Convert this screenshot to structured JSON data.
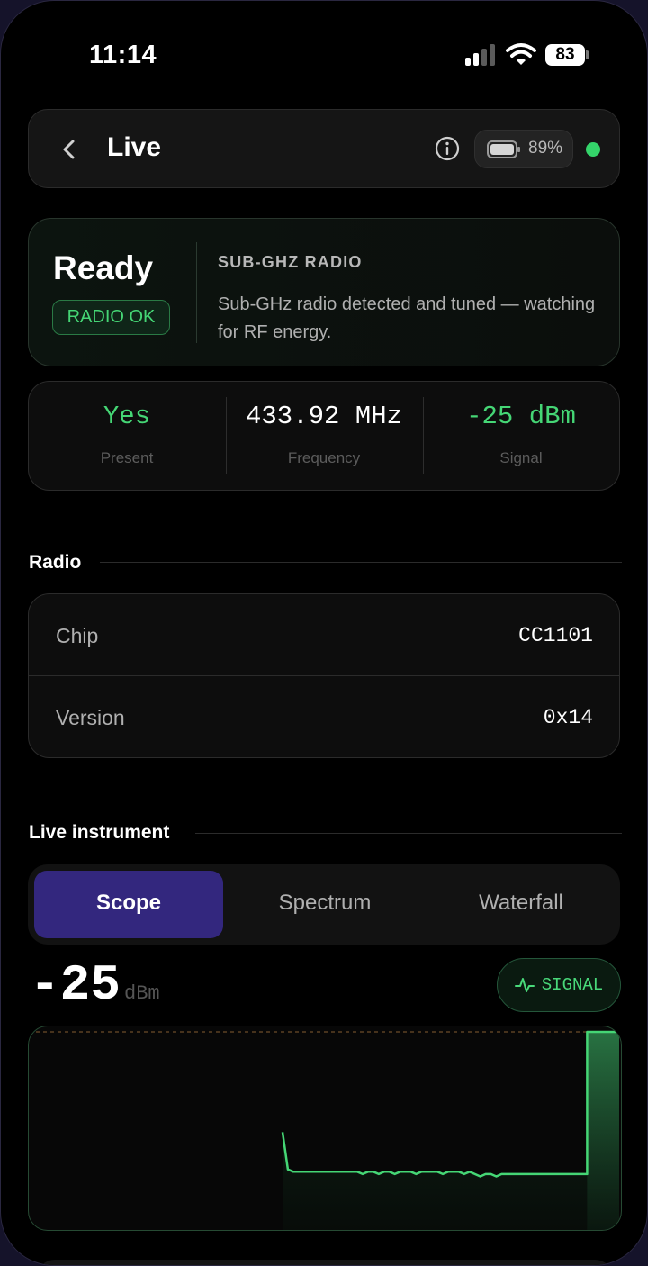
{
  "status_bar": {
    "time": "11:14",
    "battery": "83"
  },
  "header": {
    "title": "Live",
    "battery_percent": "89%",
    "connection_color": "#34d46a"
  },
  "status_card": {
    "state": "Ready",
    "badge": "RADIO OK",
    "module": "SUB-GHZ RADIO",
    "description": "Sub-GHz radio detected and tuned — watching for RF energy."
  },
  "metrics": [
    {
      "value": "Yes",
      "label": "Present",
      "color": "#45d675"
    },
    {
      "value": "433.92 MHz",
      "label": "Frequency",
      "color": "#ffffff"
    },
    {
      "value": "-25 dBm",
      "label": "Signal",
      "color": "#45d675"
    }
  ],
  "radio": {
    "section_title": "Radio",
    "rows": [
      {
        "label": "Chip",
        "value": "CC1101"
      },
      {
        "label": "Version",
        "value": "0x14"
      }
    ]
  },
  "live": {
    "section_title": "Live instrument",
    "tabs": [
      "Scope",
      "Spectrum",
      "Waterfall"
    ],
    "active_tab": "Scope",
    "reading_value": "-25",
    "reading_unit": "dBm",
    "badge": "SIGNAL",
    "accent": "#45d675"
  },
  "scope_trace": {
    "samples_dbm": [
      -68,
      -84,
      -85,
      -85,
      -85,
      -85,
      -85,
      -85,
      -85,
      -85,
      -85,
      -85,
      -85,
      -85,
      -85,
      -86,
      -85,
      -85,
      -86,
      -85,
      -85,
      -86,
      -85,
      -85,
      -85,
      -86,
      -85,
      -85,
      -85,
      -85,
      -86,
      -85,
      -85,
      -85,
      -86,
      -85,
      -86,
      -87,
      -86,
      -86,
      -87,
      -86,
      -86,
      -86,
      -86,
      -86,
      -86,
      -86,
      -86,
      -86,
      -86,
      -86,
      -86,
      -86,
      -86,
      -86,
      -86,
      -25,
      -25,
      -25,
      -25,
      -25,
      -25,
      -25
    ],
    "threshold_dbm": -25,
    "min_dbm": -110,
    "max_dbm": -25
  }
}
